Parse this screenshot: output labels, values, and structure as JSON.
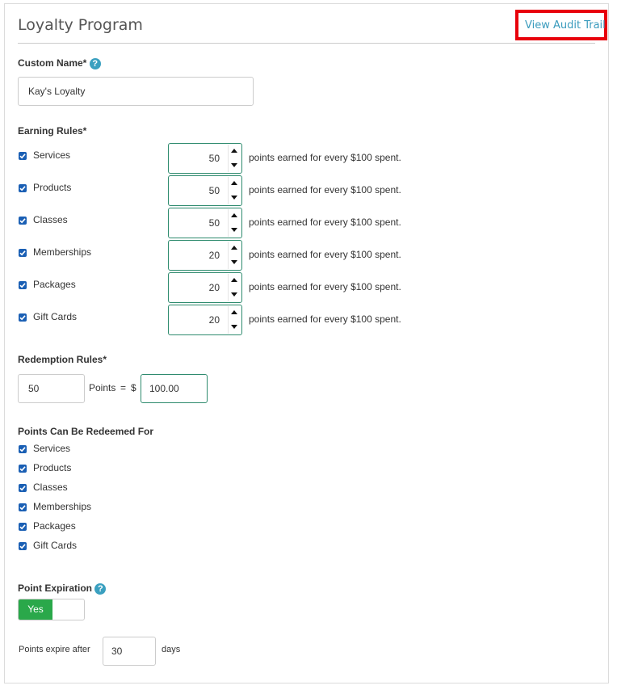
{
  "header": {
    "title": "Loyalty Program",
    "audit_link": "View Audit Trail"
  },
  "custom_name": {
    "label": "Custom Name*",
    "help": "?",
    "value": "Kay's Loyalty"
  },
  "earning_rules": {
    "label": "Earning Rules*",
    "suffix": "points earned for every $100 spent.",
    "items": [
      {
        "name": "Services",
        "checked": true,
        "points": "50"
      },
      {
        "name": "Products",
        "checked": true,
        "points": "50"
      },
      {
        "name": "Classes",
        "checked": true,
        "points": "50"
      },
      {
        "name": "Memberships",
        "checked": true,
        "points": "20"
      },
      {
        "name": "Packages",
        "checked": true,
        "points": "20"
      },
      {
        "name": "Gift Cards",
        "checked": true,
        "points": "20"
      }
    ]
  },
  "redemption_rules": {
    "label": "Redemption Rules*",
    "points": "50",
    "points_label": "Points",
    "equals": "=",
    "currency": "$",
    "amount": "100.00"
  },
  "redeem_for": {
    "label": "Points Can Be Redeemed For",
    "items": [
      {
        "name": "Services",
        "checked": true
      },
      {
        "name": "Products",
        "checked": true
      },
      {
        "name": "Classes",
        "checked": true
      },
      {
        "name": "Memberships",
        "checked": true
      },
      {
        "name": "Packages",
        "checked": true
      },
      {
        "name": "Gift Cards",
        "checked": true
      }
    ]
  },
  "point_expiration": {
    "label": "Point Expiration",
    "help": "?",
    "toggle_label": "Yes",
    "enabled": true,
    "expire_prefix": "Points expire after",
    "days_value": "30",
    "days_suffix": "days"
  },
  "colors": {
    "accent_link": "#3a9bbd",
    "highlight_box": "#e8000b",
    "toggle_on": "#2aa84a",
    "checkbox": "#1a5fb4",
    "input_focus": "#2e8b6e"
  },
  "icons": {
    "help": "question-circle-icon",
    "check": "checkmark-icon",
    "spin_up": "triangle-up-icon",
    "spin_down": "triangle-down-icon"
  }
}
